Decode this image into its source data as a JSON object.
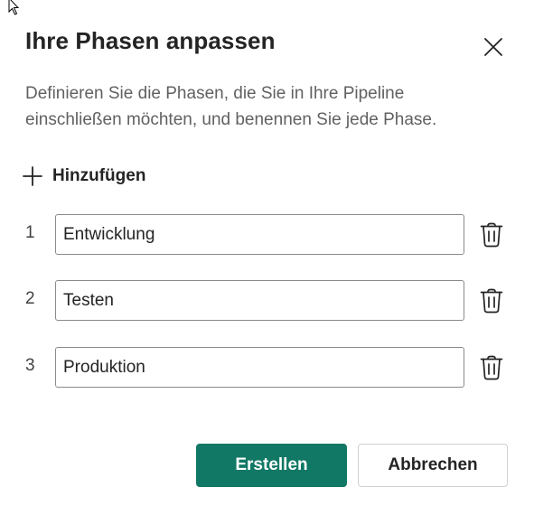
{
  "dialog": {
    "title": "Ihre Phasen anpassen",
    "description": "Definieren Sie die Phasen, die Sie in Ihre Pipeline einschließen möchten, und benennen Sie jede Phase.",
    "close_icon": "close-icon"
  },
  "add_button": {
    "label": "Hinzufügen",
    "icon": "plus-icon"
  },
  "stages": [
    {
      "number": "1",
      "value": "Entwicklung",
      "delete_icon": "trash-icon"
    },
    {
      "number": "2",
      "value": "Testen",
      "delete_icon": "trash-icon"
    },
    {
      "number": "3",
      "value": "Produktion",
      "delete_icon": "trash-icon"
    }
  ],
  "footer": {
    "create_label": "Erstellen",
    "cancel_label": "Abbrechen"
  },
  "colors": {
    "primary": "#117865",
    "text": "#242424",
    "secondary_text": "#616161",
    "input_border": "#8a8a8a"
  }
}
